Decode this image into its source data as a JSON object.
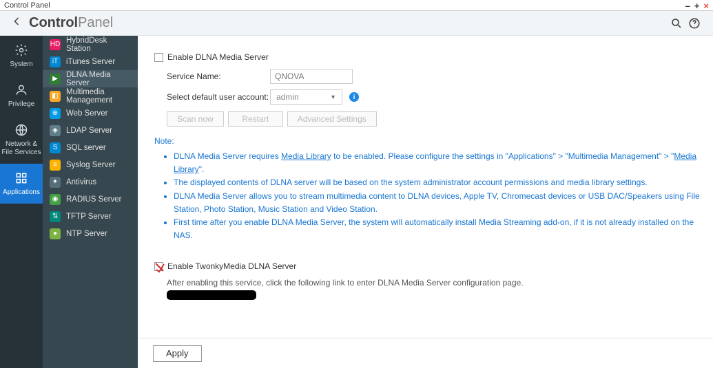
{
  "window": {
    "title": "Control Panel",
    "minimize": "–",
    "maximize": "+",
    "close": "×"
  },
  "header": {
    "title_bold": "Control",
    "title_light": "Panel"
  },
  "nav": [
    {
      "label": "System",
      "icon": "gear"
    },
    {
      "label": "Privilege",
      "icon": "user"
    },
    {
      "label": "Network &\nFile Services",
      "icon": "globe"
    },
    {
      "label": "Applications",
      "icon": "apps",
      "active": true
    }
  ],
  "sidebar": [
    {
      "label": "HybridDesk Station",
      "icon": "HD",
      "color": "#e91e63"
    },
    {
      "label": "iTunes Server",
      "icon": "iT",
      "color": "#0288d1"
    },
    {
      "label": "DLNA Media Server",
      "icon": "▶",
      "color": "#2e7d32",
      "active": true
    },
    {
      "label": "Multimedia Management",
      "icon": "◧",
      "color": "#f9a825"
    },
    {
      "label": "Web Server",
      "icon": "⊕",
      "color": "#039be5"
    },
    {
      "label": "LDAP Server",
      "icon": "◈",
      "color": "#607d8b"
    },
    {
      "label": "SQL server",
      "icon": "S",
      "color": "#0288d1"
    },
    {
      "label": "Syslog Server",
      "icon": "≡",
      "color": "#ffb300"
    },
    {
      "label": "Antivirus",
      "icon": "✦",
      "color": "#546e7a"
    },
    {
      "label": "RADIUS Server",
      "icon": "◉",
      "color": "#43a047"
    },
    {
      "label": "TFTP Server",
      "icon": "⇅",
      "color": "#00897b"
    },
    {
      "label": "NTP Server",
      "icon": "●",
      "color": "#7cb342"
    }
  ],
  "main": {
    "enable_dlna": "Enable DLNA Media Server",
    "service_name_label": "Service Name:",
    "service_name_placeholder": "QNOVA",
    "account_label": "Select default user account:",
    "account_value": "admin",
    "buttons": {
      "scan": "Scan now",
      "restart": "Restart",
      "adv": "Advanced Settings"
    },
    "note_head": "Note:",
    "notes": [
      {
        "pre": "DLNA Media Server requires ",
        "link1": "Media Library",
        "mid": " to be enabled. Please configure the settings in \"Applications\" > \"Multimedia Management\" > \"",
        "link2": "Media Library",
        "post": "\"."
      },
      {
        "text": "The displayed contents of DLNA server will be based on the system administrator account permissions and media library settings."
      },
      {
        "text": "DLNA Media Server allows you to stream multimedia content to DLNA devices, Apple TV, Chromecast devices or USB DAC/Speakers using File Station, Photo Station, Music Station and Video Station."
      },
      {
        "text": "First time after you enable DLNA Media Server, the system will automatically install Media Streaming add-on, if it is not already installed on the NAS."
      }
    ],
    "enable_twonky": "Enable TwonkyMedia DLNA Server",
    "twonky_hint": "After enabling this service, click the following link to enter DLNA Media Server configuration page.",
    "apply": "Apply"
  }
}
